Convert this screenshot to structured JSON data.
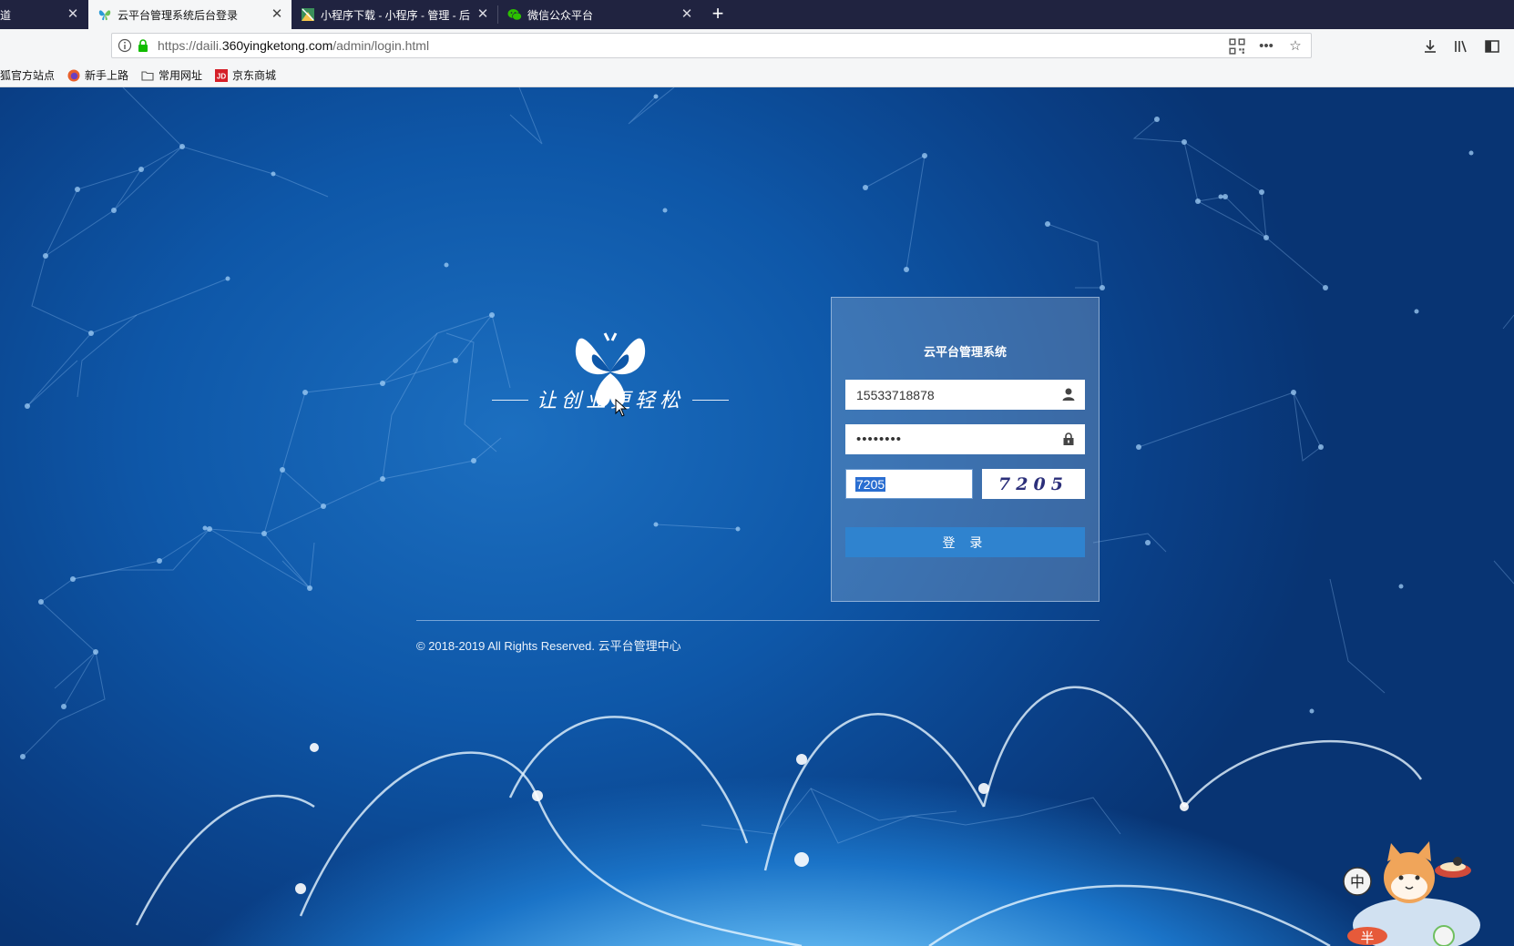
{
  "tabs": [
    {
      "title": "道",
      "favicon": "generic-icon"
    },
    {
      "title": "云平台管理系统后台登录",
      "favicon": "butterfly-icon",
      "active": true
    },
    {
      "title": "小程序下载 - 小程序 - 管理 - 后",
      "favicon": "map-icon"
    },
    {
      "title": "微信公众平台",
      "favicon": "wechat-icon"
    }
  ],
  "address": {
    "scheme": "https://daili.",
    "domain": "360yingketong.com",
    "path": "/admin/login.html"
  },
  "bookmarks": [
    {
      "label": "狐官方站点",
      "icon": "firefox-icon"
    },
    {
      "label": "新手上路",
      "icon": "firefox-icon"
    },
    {
      "label": "常用网址",
      "icon": "folder-icon"
    },
    {
      "label": "京东商城",
      "icon": "jd-icon"
    }
  ],
  "hero": {
    "slogan": "让创业更轻松"
  },
  "login": {
    "title": "云平台管理系统",
    "username": "15533718878",
    "password_mask": "••••••••",
    "captcha_input": "7205",
    "captcha_image_text": "7205",
    "submit_label": "登 录"
  },
  "footer": {
    "copyright": "© 2018-2019 All Rights Reserved. 云平台管理中心"
  },
  "mascot": {
    "left_badge": "中",
    "bottom_badge": "半"
  },
  "colors": {
    "login_button": "#2f83cf",
    "tab_bar": "#202340",
    "page_bg": "#0e57a8"
  }
}
